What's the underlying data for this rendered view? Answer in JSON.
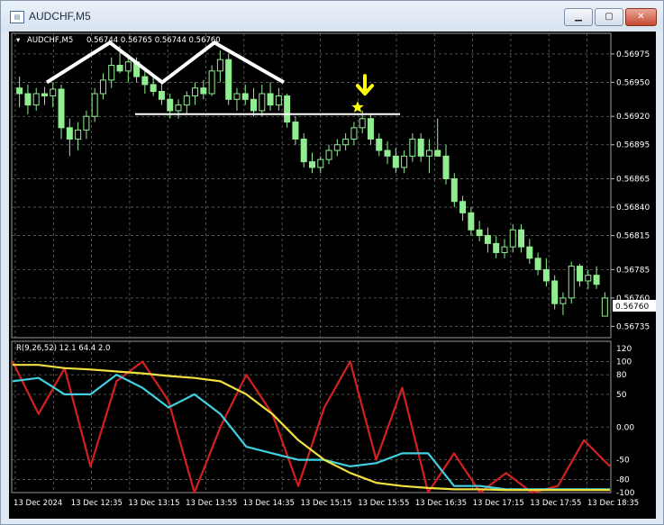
{
  "window": {
    "title": "AUDCHF,M5",
    "icon": "chart-window-icon",
    "buttons": [
      "minimize-icon",
      "maximize-icon",
      "close-icon"
    ]
  },
  "main_chart": {
    "symbol_label": "AUDCHF,M5",
    "ohlc_text": "0.56744 0.56765 0.56744 0.56760",
    "price_ticks": [
      "0.56975",
      "0.56950",
      "0.56920",
      "0.56895",
      "0.56865",
      "0.56840",
      "0.56815",
      "0.56785",
      "0.56760",
      "0.56735"
    ],
    "current_price_tag": "0.56760",
    "colors": {
      "background": "#000000",
      "grid": "#5a5a5a",
      "candle": "#90ee90",
      "annotation": "#ffffff",
      "marker": "#ffff00"
    }
  },
  "indicator": {
    "label": "R(9,26,52) 12.1 64.4 2.0",
    "ticks": [
      "120",
      "100",
      "80",
      "50",
      "0.00",
      "-50",
      "-80",
      "-100"
    ],
    "colors": {
      "red": "#d42020",
      "cyan": "#40d0e0",
      "yellow": "#f0e040"
    }
  },
  "time_axis": [
    "13 Dec 2024",
    "13 Dec 12:35",
    "13 Dec 13:15",
    "13 Dec 13:55",
    "13 Dec 14:35",
    "13 Dec 15:15",
    "13 Dec 15:55",
    "13 Dec 16:35",
    "13 Dec 17:15",
    "13 Dec 17:55",
    "13 Dec 18:35"
  ],
  "chart_data": {
    "type": "candlestick",
    "candles_ohlc": [
      [
        0.56945,
        0.56955,
        0.56928,
        0.5694
      ],
      [
        0.5694,
        0.56948,
        0.56922,
        0.5693
      ],
      [
        0.5693,
        0.56945,
        0.56925,
        0.5694
      ],
      [
        0.5694,
        0.56946,
        0.5693,
        0.56938
      ],
      [
        0.56938,
        0.5695,
        0.56928,
        0.56944
      ],
      [
        0.56944,
        0.56948,
        0.569,
        0.5691
      ],
      [
        0.5691,
        0.56918,
        0.56885,
        0.569
      ],
      [
        0.569,
        0.56915,
        0.5689,
        0.56908
      ],
      [
        0.56908,
        0.56925,
        0.569,
        0.5692
      ],
      [
        0.5692,
        0.56945,
        0.56915,
        0.5694
      ],
      [
        0.5694,
        0.56958,
        0.56935,
        0.56952
      ],
      [
        0.56952,
        0.56972,
        0.56945,
        0.56965
      ],
      [
        0.56965,
        0.56982,
        0.56958,
        0.5696
      ],
      [
        0.5696,
        0.56975,
        0.5695,
        0.56968
      ],
      [
        0.56968,
        0.56972,
        0.5695,
        0.56955
      ],
      [
        0.56955,
        0.56962,
        0.5694,
        0.56948
      ],
      [
        0.56948,
        0.56955,
        0.56938,
        0.56942
      ],
      [
        0.56942,
        0.5695,
        0.5693,
        0.56935
      ],
      [
        0.56935,
        0.5694,
        0.56918,
        0.56925
      ],
      [
        0.56925,
        0.56935,
        0.56918,
        0.5693
      ],
      [
        0.5693,
        0.56942,
        0.56922,
        0.56938
      ],
      [
        0.56938,
        0.5695,
        0.5693,
        0.56945
      ],
      [
        0.56945,
        0.56952,
        0.56935,
        0.5694
      ],
      [
        0.5694,
        0.56965,
        0.56938,
        0.5696
      ],
      [
        0.5696,
        0.56978,
        0.5695,
        0.5697
      ],
      [
        0.5697,
        0.56975,
        0.5693,
        0.56935
      ],
      [
        0.56935,
        0.56945,
        0.56925,
        0.5694
      ],
      [
        0.5694,
        0.56948,
        0.5693,
        0.56935
      ],
      [
        0.56935,
        0.56945,
        0.5692,
        0.56925
      ],
      [
        0.56925,
        0.56948,
        0.5692,
        0.5694
      ],
      [
        0.5694,
        0.5695,
        0.56925,
        0.5693
      ],
      [
        0.5693,
        0.56945,
        0.56925,
        0.56938
      ],
      [
        0.56938,
        0.5694,
        0.5691,
        0.56915
      ],
      [
        0.56915,
        0.5692,
        0.56895,
        0.569
      ],
      [
        0.569,
        0.56905,
        0.56875,
        0.5688
      ],
      [
        0.5688,
        0.56888,
        0.5687,
        0.56875
      ],
      [
        0.56875,
        0.56885,
        0.5687,
        0.56882
      ],
      [
        0.56882,
        0.56895,
        0.56878,
        0.5689
      ],
      [
        0.5689,
        0.569,
        0.56885,
        0.56895
      ],
      [
        0.56895,
        0.56905,
        0.5689,
        0.569
      ],
      [
        0.569,
        0.56915,
        0.56895,
        0.5691
      ],
      [
        0.5691,
        0.56925,
        0.56905,
        0.56918
      ],
      [
        0.56918,
        0.56922,
        0.56895,
        0.569
      ],
      [
        0.569,
        0.56905,
        0.56885,
        0.5689
      ],
      [
        0.5689,
        0.56898,
        0.56878,
        0.56885
      ],
      [
        0.56885,
        0.56892,
        0.5687,
        0.56875
      ],
      [
        0.56875,
        0.5689,
        0.5687,
        0.56885
      ],
      [
        0.56885,
        0.56905,
        0.5688,
        0.569
      ],
      [
        0.569,
        0.56905,
        0.5688,
        0.56885
      ],
      [
        0.56885,
        0.569,
        0.5687,
        0.5689
      ],
      [
        0.5689,
        0.56918,
        0.56885,
        0.56885
      ],
      [
        0.56885,
        0.56895,
        0.5686,
        0.56865
      ],
      [
        0.56865,
        0.5687,
        0.5684,
        0.56845
      ],
      [
        0.56845,
        0.5685,
        0.56828,
        0.56835
      ],
      [
        0.56835,
        0.5684,
        0.56815,
        0.5682
      ],
      [
        0.5682,
        0.56828,
        0.5681,
        0.56815
      ],
      [
        0.56815,
        0.56822,
        0.568,
        0.56808
      ],
      [
        0.56808,
        0.56815,
        0.56795,
        0.568
      ],
      [
        0.568,
        0.56812,
        0.56795,
        0.56805
      ],
      [
        0.56805,
        0.56825,
        0.568,
        0.5682
      ],
      [
        0.5682,
        0.56825,
        0.568,
        0.56805
      ],
      [
        0.56805,
        0.56812,
        0.5679,
        0.56795
      ],
      [
        0.56795,
        0.568,
        0.5678,
        0.56785
      ],
      [
        0.56785,
        0.56795,
        0.5677,
        0.56775
      ],
      [
        0.56775,
        0.5678,
        0.5675,
        0.56755
      ],
      [
        0.56755,
        0.56765,
        0.56745,
        0.5676
      ],
      [
        0.5676,
        0.56792,
        0.56755,
        0.56788
      ],
      [
        0.56788,
        0.5679,
        0.5677,
        0.56775
      ],
      [
        0.56775,
        0.56785,
        0.56768,
        0.5678
      ],
      [
        0.5678,
        0.56788,
        0.56768,
        0.56772
      ],
      [
        0.56744,
        0.56765,
        0.56744,
        0.5676
      ]
    ],
    "pattern_annotation": {
      "zigzag_prices": [
        0.5695,
        0.56985,
        0.5695,
        0.56985,
        0.5695
      ],
      "neckline_price": 0.56922
    },
    "marker_price": 0.56928,
    "price_range": [
      0.56725,
      0.5699
    ],
    "indicator_series": [
      {
        "color": "red",
        "values": [
          100,
          20,
          90,
          -60,
          70,
          100,
          40,
          -100,
          0,
          80,
          20,
          -90,
          30,
          100,
          -50,
          60,
          -100,
          -40,
          -100,
          -70,
          -100,
          -90,
          -20,
          -60
        ]
      },
      {
        "color": "cyan",
        "values": [
          70,
          75,
          50,
          50,
          80,
          60,
          30,
          50,
          20,
          -30,
          -40,
          -50,
          -50,
          -60,
          -55,
          -40,
          -40,
          -90,
          -90,
          -95,
          -95,
          -95,
          -95,
          -95
        ]
      },
      {
        "color": "yellow",
        "values": [
          95,
          95,
          90,
          88,
          85,
          82,
          78,
          75,
          70,
          50,
          20,
          -20,
          -50,
          -70,
          -85,
          -90,
          -93,
          -95,
          -95,
          -96,
          -96,
          -96,
          -96,
          -96
        ]
      }
    ],
    "indicator_range": [
      -100,
      120
    ]
  }
}
